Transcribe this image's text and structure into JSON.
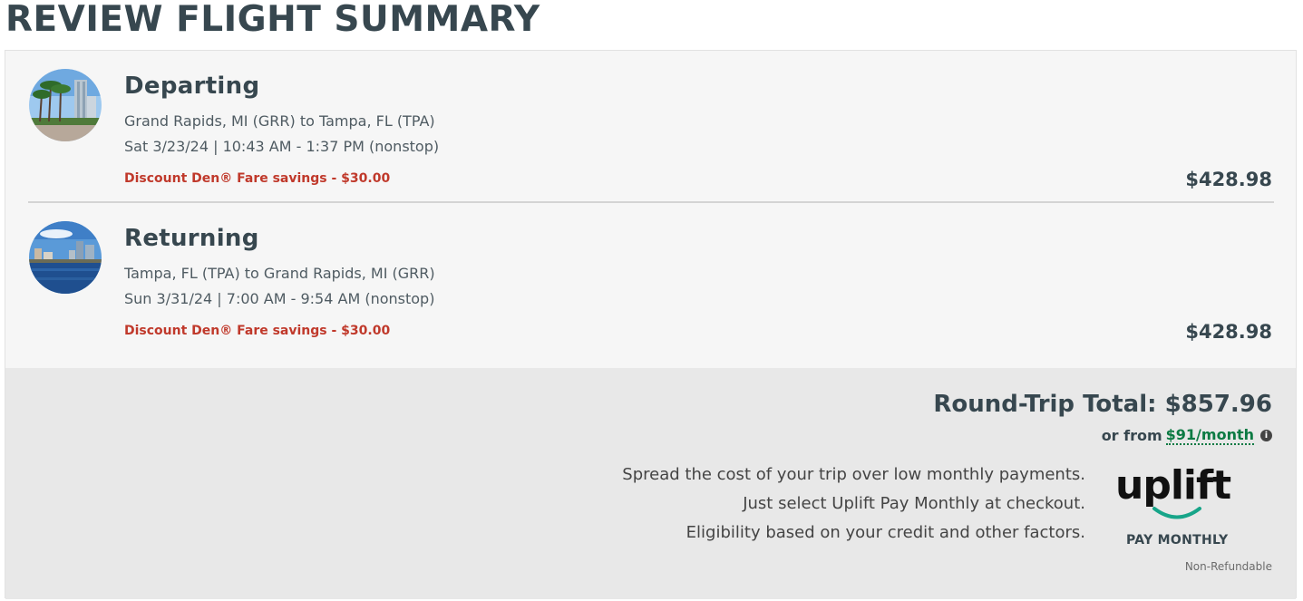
{
  "page": {
    "title": "REVIEW FLIGHT SUMMARY"
  },
  "departing": {
    "heading": "Departing",
    "route": "Grand Rapids, MI (GRR) to Tampa, FL (TPA)",
    "time": "Sat 3/23/24 | 10:43 AM - 1:37 PM (nonstop)",
    "savings": "Discount Den® Fare savings - $30.00",
    "price": "$428.98",
    "image": "palm-city-skyline-photo"
  },
  "returning": {
    "heading": "Returning",
    "route": "Tampa, FL (TPA) to Grand Rapids, MI (GRR)",
    "time": "Sun 3/31/24 | 7:00 AM - 9:54 AM (nonstop)",
    "savings": "Discount Den® Fare savings - $30.00",
    "price": "$428.98",
    "image": "waterfront-city-photo"
  },
  "total": {
    "label": "Round-Trip Total: $857.96",
    "monthly_prefix": "or from",
    "monthly_link": "$91/month",
    "info_icon": "info-icon"
  },
  "promo": {
    "line1": "Spread the cost of your trip over low monthly payments.",
    "line2": "Just select Uplift Pay Monthly at checkout.",
    "line3": "Eligibility based on your credit and other factors."
  },
  "uplift": {
    "logo_text": "uplift",
    "tagline": "PAY MONTHLY",
    "brand_color": "#17a589"
  },
  "footer": {
    "non_refundable": "Non-Refundable"
  },
  "colors": {
    "title": "#37474f",
    "savings": "#c0392b",
    "link": "#0c7a43",
    "panel": "#e8e8e8"
  }
}
